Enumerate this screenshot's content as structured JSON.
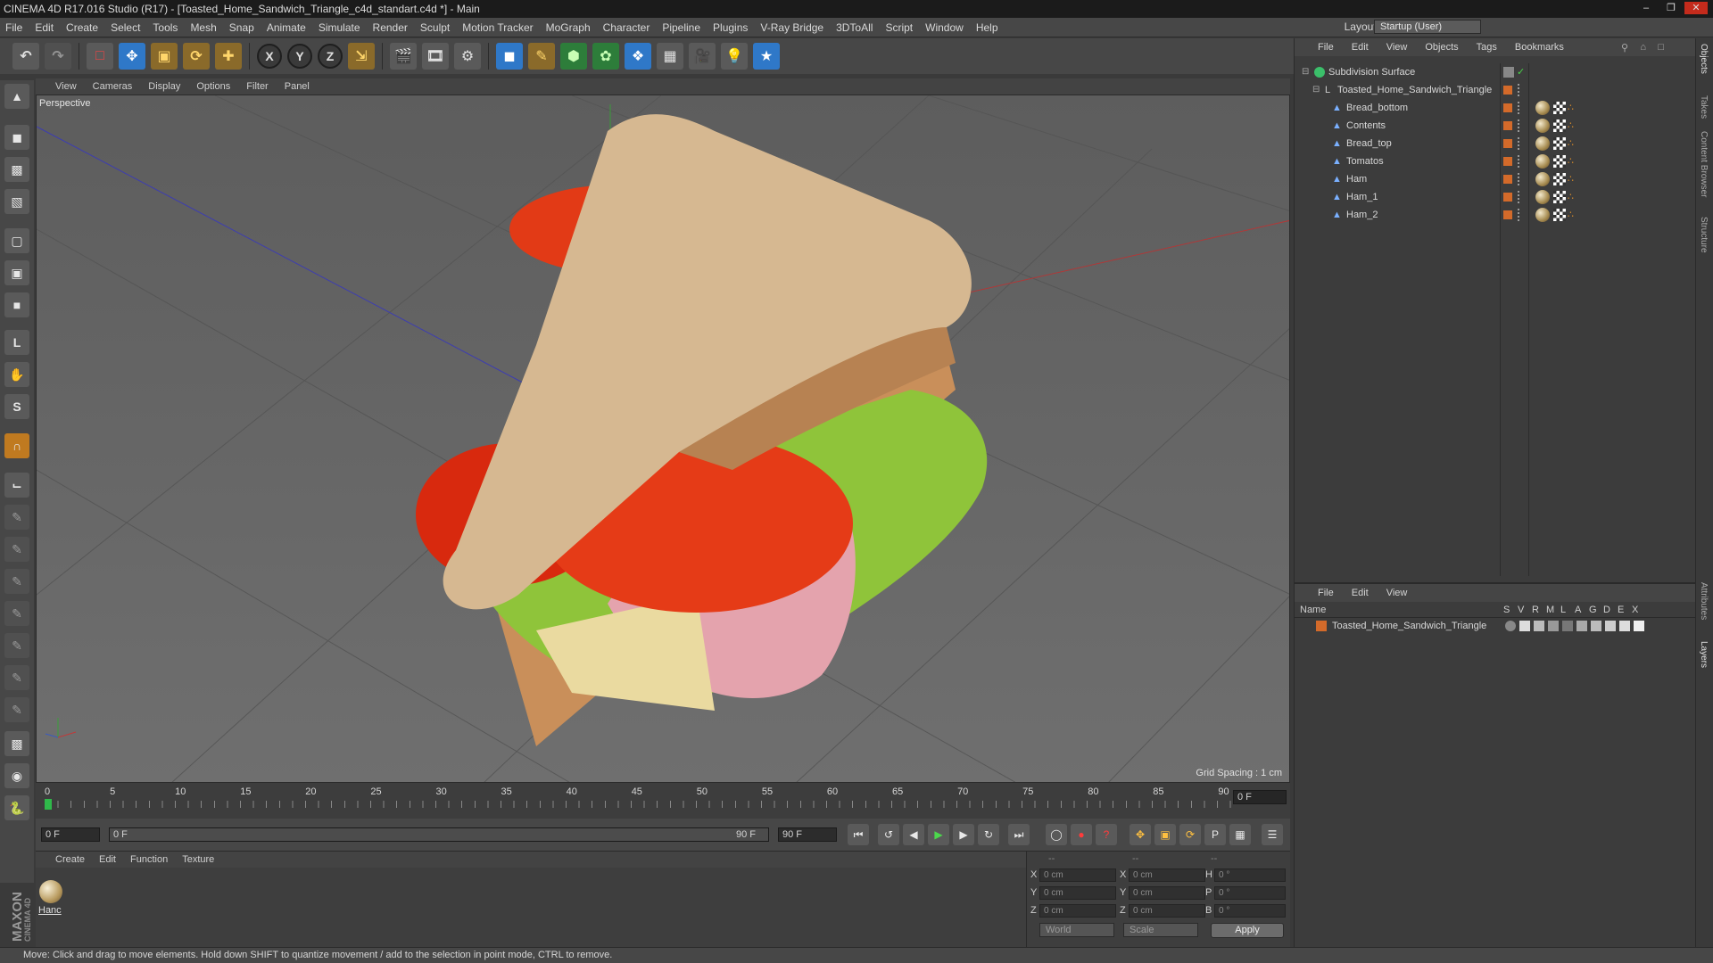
{
  "window": {
    "title": "CINEMA 4D R17.016 Studio (R17) - [Toasted_Home_Sandwich_Triangle_c4d_standart.c4d *] - Main"
  },
  "menubar": {
    "items": [
      "File",
      "Edit",
      "Create",
      "Select",
      "Tools",
      "Mesh",
      "Snap",
      "Animate",
      "Simulate",
      "Render",
      "Sculpt",
      "Motion Tracker",
      "MoGraph",
      "Character",
      "Pipeline",
      "Plugins",
      "V-Ray Bridge",
      "3DToAll",
      "Script",
      "Window",
      "Help"
    ],
    "layout_label": "Layout:",
    "layout_value": "Startup (User)"
  },
  "toolbar": {
    "axis_x": "X",
    "axis_y": "Y",
    "axis_z": "Z"
  },
  "viewport": {
    "menu": [
      "View",
      "Cameras",
      "Display",
      "Options",
      "Filter",
      "Panel"
    ],
    "label": "Perspective",
    "grid_spacing": "Grid Spacing : 1 cm"
  },
  "timeline": {
    "ticks": [
      "0",
      "5",
      "10",
      "15",
      "20",
      "25",
      "30",
      "35",
      "40",
      "45",
      "50",
      "55",
      "60",
      "65",
      "70",
      "75",
      "80",
      "85",
      "90"
    ],
    "current_frame": "0 F",
    "start_field": "0 F",
    "range_start": "0 F",
    "range_end": "90 F",
    "end_field": "90 F"
  },
  "material_manager": {
    "menu": [
      "Create",
      "Edit",
      "Function",
      "Texture"
    ],
    "material_name": "Hanc"
  },
  "coordinates": {
    "header_a": "--",
    "header_b": "--",
    "header_c": "--",
    "rows": [
      {
        "l1": "X",
        "v1": "0 cm",
        "l2": "X",
        "v2": "0 cm",
        "l3": "H",
        "v3": "0 °"
      },
      {
        "l1": "Y",
        "v1": "0 cm",
        "l2": "Y",
        "v2": "0 cm",
        "l3": "P",
        "v3": "0 °"
      },
      {
        "l1": "Z",
        "v1": "0 cm",
        "l2": "Z",
        "v2": "0 cm",
        "l3": "B",
        "v3": "0 °"
      }
    ],
    "mode": "World",
    "transform": "Scale",
    "apply": "Apply"
  },
  "object_manager": {
    "menu": [
      "File",
      "Edit",
      "View",
      "Objects",
      "Tags",
      "Bookmarks"
    ],
    "objects": [
      {
        "name": "Subdivision Surface",
        "level": 0
      },
      {
        "name": "Toasted_Home_Sandwich_Triangle",
        "level": 1
      },
      {
        "name": "Bread_bottom",
        "level": 2
      },
      {
        "name": "Contents",
        "level": 2
      },
      {
        "name": "Bread_top",
        "level": 2
      },
      {
        "name": "Tomatos",
        "level": 2
      },
      {
        "name": "Ham",
        "level": 2
      },
      {
        "name": "Ham_1",
        "level": 2
      },
      {
        "name": "Ham_2",
        "level": 2
      }
    ]
  },
  "layer_manager": {
    "menu": [
      "File",
      "Edit",
      "View"
    ],
    "headers": {
      "name": "Name",
      "s": "S",
      "v": "V",
      "r": "R",
      "m": "M",
      "l": "L",
      "a": "A",
      "g": "G",
      "d": "D",
      "e": "E",
      "x": "X"
    },
    "layer_name": "Toasted_Home_Sandwich_Triangle"
  },
  "side_tabs": [
    "Objects",
    "Takes",
    "Content Browser",
    "Structure",
    "Attributes",
    "Layers"
  ],
  "status": {
    "text": "Move: Click and drag to move elements. Hold down SHIFT to quantize movement / add to the selection in point mode, CTRL to remove."
  },
  "branding": {
    "logo": "MAXON CINEMA 4D"
  }
}
